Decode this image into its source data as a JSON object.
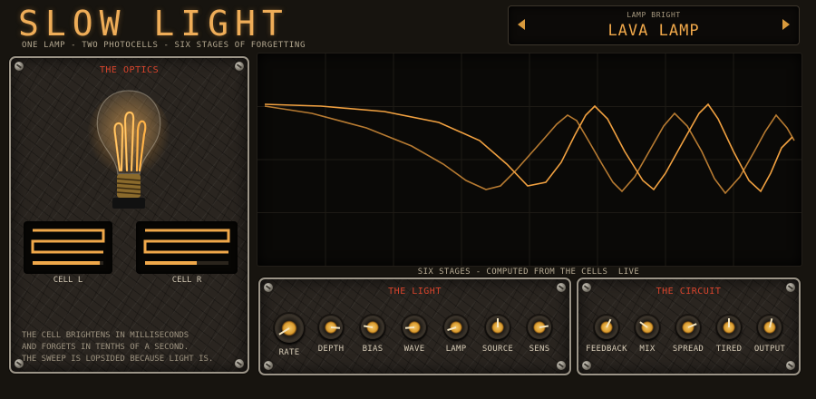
{
  "header": {
    "title": "SLOW LIGHT",
    "subtitle": "ONE LAMP - TWO PHOTOCELLS - SIX STAGES OF FORGETTING"
  },
  "preset": {
    "category": "LAMP BRIGHT",
    "name": "LAVA LAMP",
    "prev_icon": "triangle-left-icon",
    "next_icon": "triangle-right-icon"
  },
  "optics": {
    "title": "THE OPTICS",
    "cell_left_label": "CELL L",
    "cell_right_label": "CELL R",
    "cell_left_level": 0.95,
    "cell_right_level": 0.62,
    "description": [
      "THE CELL BRIGHTENS IN MILLISECONDS",
      "AND FORGETS IN TENTHS OF A SECOND.",
      "THE SWEEP IS LOPSIDED BECAUSE LIGHT IS."
    ]
  },
  "scope": {
    "caption": "SIX STAGES - COMPUTED FROM THE CELLS",
    "status": "LIVE"
  },
  "light_section": {
    "title": "THE LIGHT",
    "knobs": [
      {
        "label": "RATE",
        "value": 0.05
      },
      {
        "label": "DEPTH",
        "value": 0.85
      },
      {
        "label": "BIAS",
        "value": 0.2
      },
      {
        "label": "WAVE",
        "value": 0.15
      },
      {
        "label": "LAMP",
        "value": 0.1
      },
      {
        "label": "SOURCE",
        "value": 0.5
      },
      {
        "label": "SENS",
        "value": 0.8
      }
    ]
  },
  "circuit_section": {
    "title": "THE CIRCUIT",
    "knobs": [
      {
        "label": "FEEDBACK",
        "value": 0.6
      },
      {
        "label": "MIX",
        "value": 0.3
      },
      {
        "label": "SPREAD",
        "value": 0.75
      },
      {
        "label": "TIRED",
        "value": 0.5
      },
      {
        "label": "OUTPUT",
        "value": 0.55
      }
    ]
  },
  "colors": {
    "accent": "#f0a84a",
    "title": "#efad58",
    "section_title": "#d8442c",
    "trace": "#f0a040"
  }
}
